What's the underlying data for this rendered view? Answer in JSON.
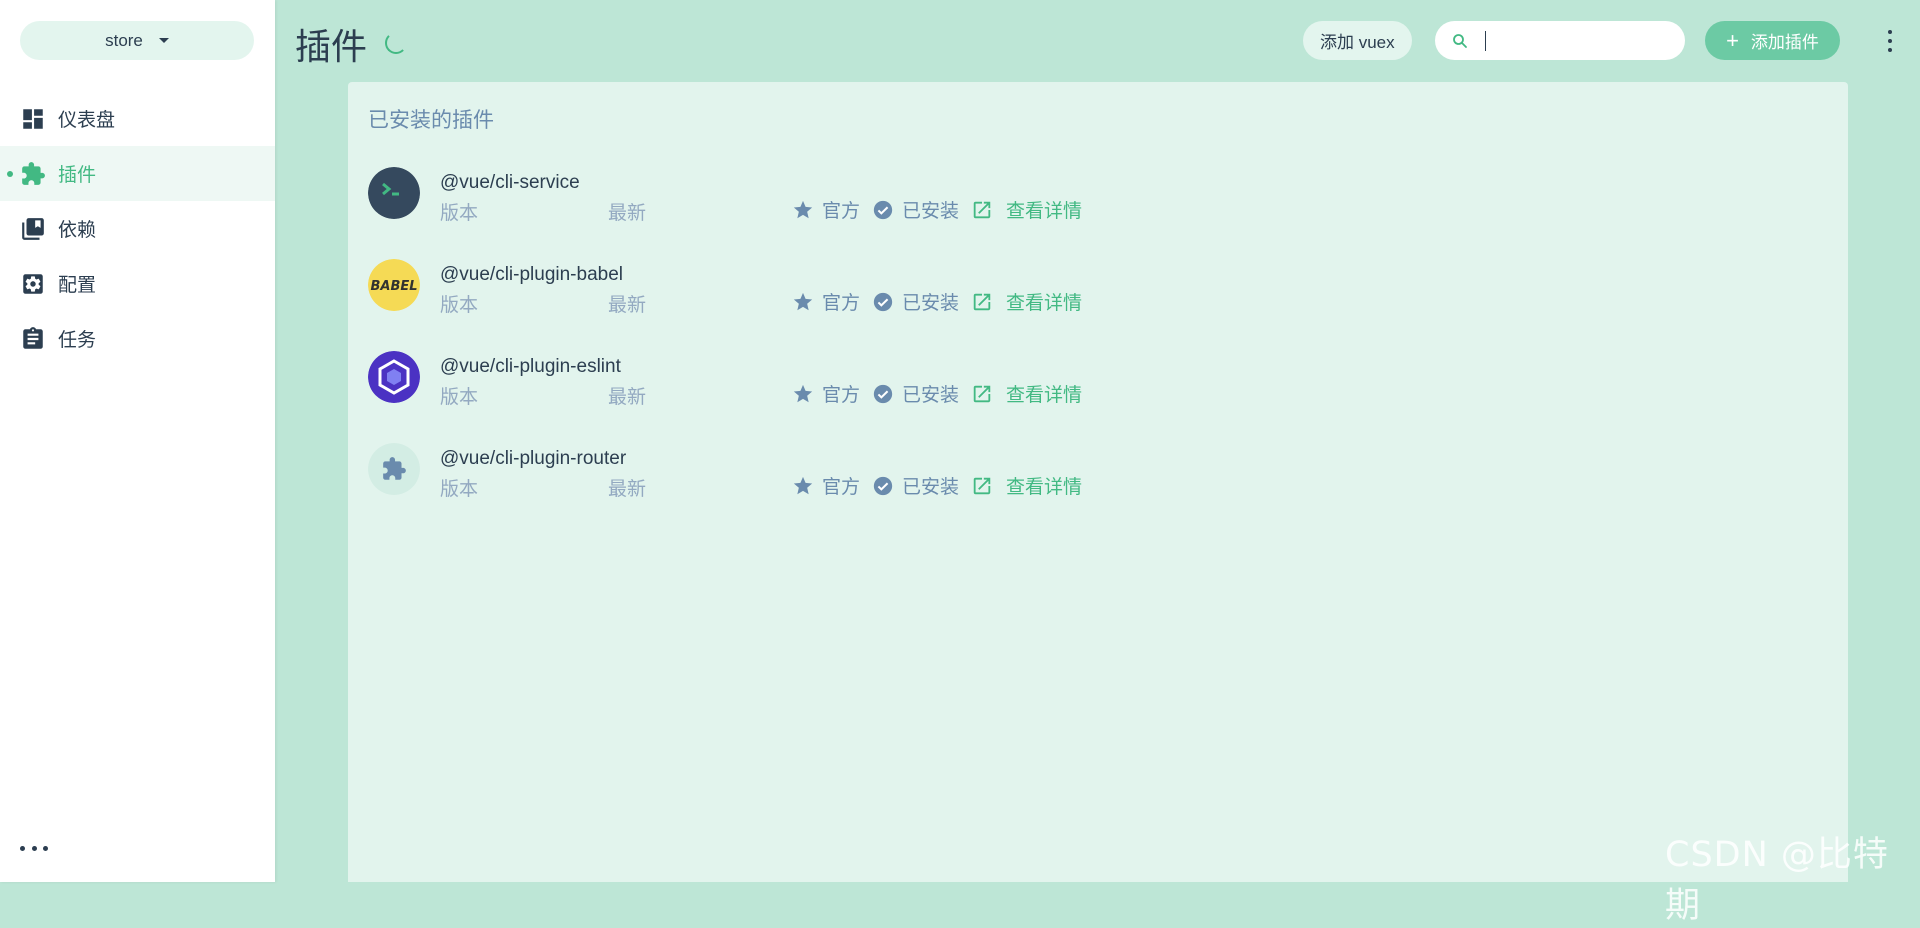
{
  "sidebar": {
    "project_name": "store",
    "items": [
      {
        "label": "仪表盘",
        "icon": "dashboard-icon"
      },
      {
        "label": "插件",
        "icon": "puzzle-icon"
      },
      {
        "label": "依赖",
        "icon": "library-icon"
      },
      {
        "label": "配置",
        "icon": "settings-icon"
      },
      {
        "label": "任务",
        "icon": "clipboard-icon"
      }
    ],
    "active_index": 1
  },
  "header": {
    "title": "插件",
    "add_vuex_label": "添加 vuex",
    "search_placeholder": "",
    "search_value": "",
    "add_plugin_label": "添加插件"
  },
  "panel": {
    "title": "已安装的插件",
    "plugins": [
      {
        "name": "@vue/cli-service",
        "version_label": "版本",
        "latest_label": "最新",
        "official_label": "官方",
        "installed_label": "已安装",
        "details_label": "查看详情",
        "logo": "terminal-logo"
      },
      {
        "name": "@vue/cli-plugin-babel",
        "version_label": "版本",
        "latest_label": "最新",
        "official_label": "官方",
        "installed_label": "已安装",
        "details_label": "查看详情",
        "logo": "babel-logo"
      },
      {
        "name": "@vue/cli-plugin-eslint",
        "version_label": "版本",
        "latest_label": "最新",
        "official_label": "官方",
        "installed_label": "已安装",
        "details_label": "查看详情",
        "logo": "eslint-logo"
      },
      {
        "name": "@vue/cli-plugin-router",
        "version_label": "版本",
        "latest_label": "最新",
        "official_label": "官方",
        "installed_label": "已安装",
        "details_label": "查看详情",
        "logo": "puzzle-logo"
      }
    ]
  },
  "watermark": "CSDN @比特期",
  "colors": {
    "accent": "#42b983",
    "background": "#bde6d6",
    "panel": "#e2f4ed",
    "text": "#2c3e50",
    "muted": "#6a8bad"
  }
}
